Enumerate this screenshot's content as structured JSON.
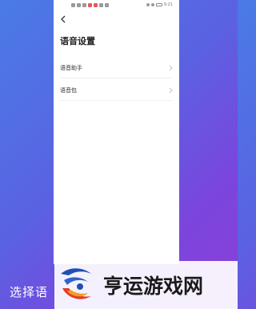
{
  "page": {
    "title": "语音设置",
    "items": [
      {
        "label": "语音助手"
      },
      {
        "label": "语音包"
      }
    ]
  },
  "status_bar": {
    "time": "9:21"
  },
  "background": {
    "caption_partial": "选择语"
  },
  "watermark": {
    "text": "亨运游戏网"
  },
  "colors": {
    "bg_start": "#4a7be6",
    "bg_end": "#8a3fd8",
    "panel": "#ffffff"
  },
  "icons": {
    "back": "chevron-left-icon",
    "row_arrow": "chevron-right-icon"
  }
}
